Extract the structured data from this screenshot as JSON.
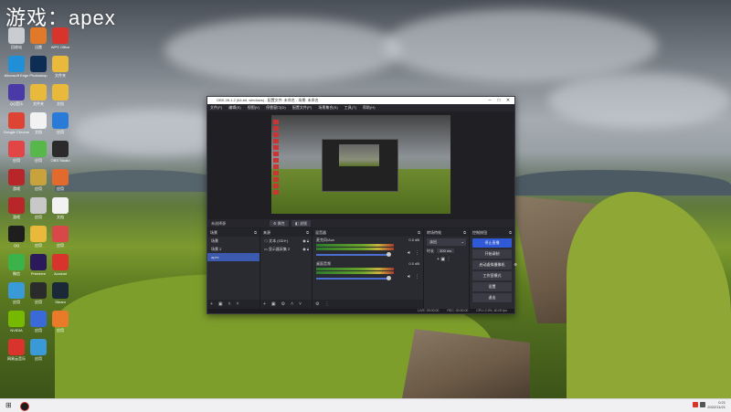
{
  "watermark": "游戏：apex",
  "desktop_icons": [
    {
      "label": "回收站",
      "color": "#c9ccd1",
      "icon": "recycle-bin-icon"
    },
    {
      "label": "迅雷",
      "color": "#e07a2a",
      "icon": "app-icon"
    },
    {
      "label": "WPS Office",
      "color": "#d9342b",
      "icon": "wps-icon"
    },
    {
      "label": "Microsoft Edge",
      "color": "#1f8fd8",
      "icon": "edge-icon"
    },
    {
      "label": "Photoshop",
      "color": "#0d2d55",
      "icon": "photoshop-icon"
    },
    {
      "label": "文件夹",
      "color": "#e8b93a",
      "icon": "folder-icon"
    },
    {
      "label": "QQ音乐",
      "color": "#4a3aa8",
      "icon": "app-icon"
    },
    {
      "label": "文件夹",
      "color": "#e8b93a",
      "icon": "folder-icon"
    },
    {
      "label": "文档",
      "color": "#e8b93a",
      "icon": "document-icon"
    },
    {
      "label": "Google Chrome",
      "color": "#dd4433",
      "icon": "chrome-icon"
    },
    {
      "label": "文档",
      "color": "#f2f2f2",
      "icon": "document-icon"
    },
    {
      "label": "应用",
      "color": "#2a7ad8",
      "icon": "app-icon"
    },
    {
      "label": "应用",
      "color": "#e24545",
      "icon": "app-icon"
    },
    {
      "label": "应用",
      "color": "#56b84a",
      "icon": "app-icon"
    },
    {
      "label": "OBS Studio",
      "color": "#2b2b2b",
      "icon": "obs-icon"
    },
    {
      "label": "游戏",
      "color": "#b8262a",
      "icon": "game-icon"
    },
    {
      "label": "应用",
      "color": "#c8a23c",
      "icon": "app-icon"
    },
    {
      "label": "应用",
      "color": "#e26a2c",
      "icon": "app-icon"
    },
    {
      "label": "游戏",
      "color": "#b8262a",
      "icon": "game-icon"
    },
    {
      "label": "应用",
      "color": "#c8c8c8",
      "icon": "app-icon"
    },
    {
      "label": "文档",
      "color": "#f2f2f2",
      "icon": "document-icon"
    },
    {
      "label": "QQ",
      "color": "#1e1e1e",
      "icon": "qq-icon"
    },
    {
      "label": "应用",
      "color": "#e8b93a",
      "icon": "app-icon"
    },
    {
      "label": "应用",
      "color": "#d84848",
      "icon": "app-icon"
    },
    {
      "label": "微信",
      "color": "#3cb34a",
      "icon": "wechat-icon"
    },
    {
      "label": "Premiere",
      "color": "#2a1a5a",
      "icon": "premiere-icon"
    },
    {
      "label": "Acrobat",
      "color": "#d9342b",
      "icon": "acrobat-icon"
    },
    {
      "label": "应用",
      "color": "#3a9ad8",
      "icon": "app-icon"
    },
    {
      "label": "应用",
      "color": "#2b2b2b",
      "icon": "app-icon"
    },
    {
      "label": "Steam",
      "color": "#1b2838",
      "icon": "steam-icon"
    },
    {
      "label": "NVIDIA",
      "color": "#76b900",
      "icon": "nvidia-icon"
    },
    {
      "label": "应用",
      "color": "#3a6ad8",
      "icon": "app-icon"
    },
    {
      "label": "应用",
      "color": "#e87a2a",
      "icon": "app-icon"
    },
    {
      "label": "网易云音乐",
      "color": "#d9342b",
      "icon": "music-icon"
    },
    {
      "label": "应用",
      "color": "#3a9ad8",
      "icon": "app-icon"
    }
  ],
  "obs": {
    "title": "OBS 28.1.2 (64-bit, windows) - 配置文件: 未命名 - 场景: 未命名",
    "menu": [
      "文件(F)",
      "编辑(E)",
      "视图(V)",
      "停靠窗口(D)",
      "配置文件(P)",
      "场景集合(S)",
      "工具(T)",
      "帮助(H)"
    ],
    "source_toolbar": {
      "label": "未选择源",
      "properties": "属性",
      "filters": "滤镜"
    },
    "docks": {
      "scenes": {
        "title": "场景",
        "items": [
          "场景",
          "场景 2",
          "apex"
        ],
        "selected": 2
      },
      "sources": {
        "title": "来源",
        "items": [
          "文本 (GDI+)",
          "显示器采集 2"
        ]
      },
      "mixer": {
        "title": "混音器",
        "channels": [
          {
            "name": "麦克风/Aux",
            "db": "0.0 dB"
          },
          {
            "name": "桌面音频",
            "db": "0.0 dB"
          }
        ]
      },
      "transitions": {
        "title": "转场特效",
        "type": "淡出",
        "duration_label": "时长",
        "duration": "300 ms"
      },
      "controls": {
        "title": "控制按钮",
        "buttons": [
          "停止直播",
          "开始录制",
          "启动虚拟摄像机",
          "工作室模式",
          "设置",
          "退出"
        ]
      }
    },
    "status": {
      "live": "LIVE: 00:00:00",
      "rec": "REC: 00:00:00",
      "cpu": "CPU: 0.3%, 60.00 fps"
    }
  },
  "taskbar": {
    "time": "0:21",
    "date": "2022/11/21"
  }
}
